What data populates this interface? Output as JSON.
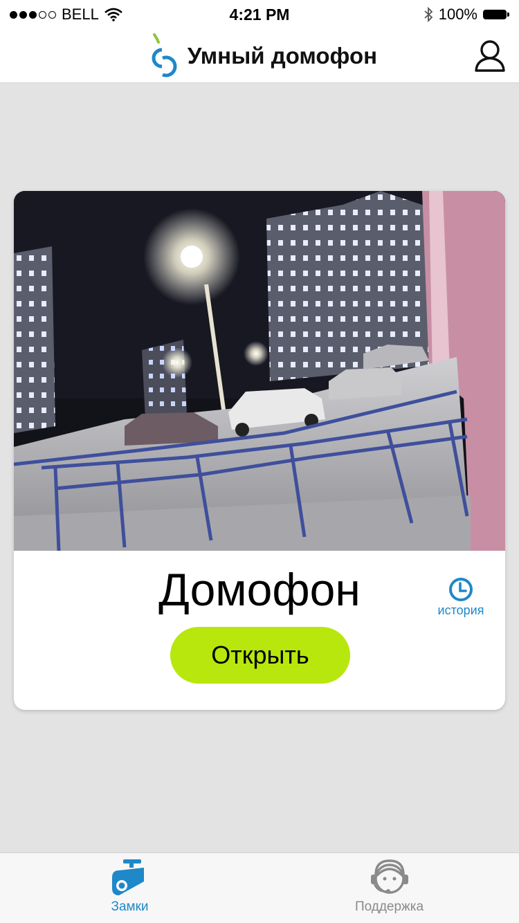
{
  "status_bar": {
    "carrier": "BELL",
    "signal_bars_filled": 3,
    "signal_bars_total": 5,
    "time": "4:21 PM",
    "battery": "100%",
    "icons": [
      "wifi-icon",
      "bluetooth-icon",
      "battery-icon"
    ]
  },
  "header": {
    "title": "Умный домофон",
    "logo": "brand-logo",
    "profile_icon": "user-icon"
  },
  "intercom": {
    "name": "Домофон",
    "history_label": "история",
    "open_label": "Открыть",
    "camera": "night-courtyard-camera-feed"
  },
  "tabs": [
    {
      "label": "Замки",
      "icon": "camera-icon",
      "active": true
    },
    {
      "label": "Поддержка",
      "icon": "support-agent-icon",
      "active": false
    }
  ],
  "colors": {
    "accent": "#1e88c8",
    "open_button": "#b8e70d",
    "logo_green": "#8cc63e",
    "background": "#e3e3e3"
  }
}
